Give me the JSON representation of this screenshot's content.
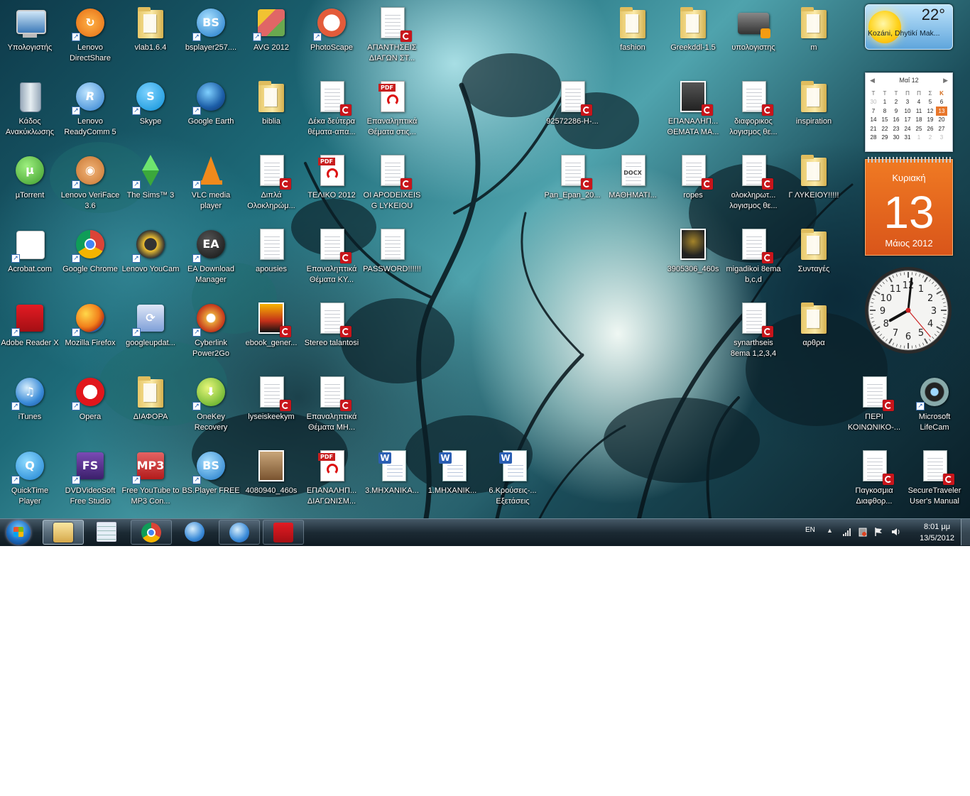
{
  "desktop_icons": [
    {
      "label": "Υπολογιστής",
      "type": "computer"
    },
    {
      "label": "Lenovo DirectShare",
      "type": "directshare",
      "shortcut": true
    },
    {
      "label": "vlab1.6.4",
      "type": "folder"
    },
    {
      "label": "bsplayer257....",
      "type": "bsplayer",
      "shortcut": true
    },
    {
      "label": "AVG 2012",
      "type": "avg",
      "shortcut": true
    },
    {
      "label": "PhotoScape",
      "type": "photoscape",
      "shortcut": true
    },
    {
      "label": "ΑΠΑΝΤΗΣΕΙΣ ΔΙΑΓΩΝ ΣΤ...",
      "type": "pdfthumb"
    },
    {
      "label": "Κάδος Ανακύκλωσης",
      "type": "recycle"
    },
    {
      "label": "Lenovo ReadyComm 5",
      "type": "readycomm",
      "shortcut": true
    },
    {
      "label": "Skype",
      "type": "skype",
      "shortcut": true
    },
    {
      "label": "Google Earth",
      "type": "earth",
      "shortcut": true
    },
    {
      "label": "biblia",
      "type": "folder"
    },
    {
      "label": "Δέκα δεύτερα θέματα-απα...",
      "type": "pdfthumb"
    },
    {
      "label": "Επαναληπτικά Θέματα στις...",
      "type": "pdf"
    },
    {
      "label": "µTorrent",
      "type": "utorrent"
    },
    {
      "label": "Lenovo VeriFace 3.6",
      "type": "veriface",
      "shortcut": true
    },
    {
      "label": "The Sims™ 3",
      "type": "sims",
      "shortcut": true
    },
    {
      "label": "VLC media player",
      "type": "vlc",
      "shortcut": true
    },
    {
      "label": "Διπλά Ολοκληρώμ...",
      "type": "pdfthumb"
    },
    {
      "label": "ΤΕΛΙΚΟ 2012",
      "type": "pdf"
    },
    {
      "label": "OI APODEIXEIS G LYKEIOU",
      "type": "pdfthumb"
    },
    {
      "label": "Acrobat.com",
      "type": "acrobatcom",
      "shortcut": true
    },
    {
      "label": "Google Chrome",
      "type": "chrome",
      "shortcut": true
    },
    {
      "label": "Lenovo YouCam",
      "type": "youcam",
      "shortcut": true
    },
    {
      "label": "EA Download Manager",
      "type": "ea",
      "shortcut": true
    },
    {
      "label": "apousies",
      "type": "doc"
    },
    {
      "label": "Επαναληπτικά Θέματα ΚΥ...",
      "type": "pdfthumb"
    },
    {
      "label": "PASSWORD!!!!!!",
      "type": "doc"
    },
    {
      "label": "Adobe Reader X",
      "type": "reader",
      "shortcut": true
    },
    {
      "label": "Mozilla Firefox",
      "type": "firefox",
      "shortcut": true
    },
    {
      "label": "googleupdat...",
      "type": "gupdate",
      "shortcut": true
    },
    {
      "label": "Cyberlink Power2Go",
      "type": "power2go",
      "shortcut": true
    },
    {
      "label": "ebook_gener...",
      "type": "ebook"
    },
    {
      "label": "Stereo talantosi",
      "type": "pdfthumb"
    },
    {
      "label": "iTunes",
      "type": "itunes",
      "shortcut": true
    },
    {
      "label": "Opera",
      "type": "opera",
      "shortcut": true
    },
    {
      "label": "ΔΙΑΦΟΡΑ",
      "type": "folder"
    },
    {
      "label": "OneKey Recovery",
      "type": "onekey",
      "shortcut": true
    },
    {
      "label": "lyseiskeekym",
      "type": "pdfthumb"
    },
    {
      "label": "Επαναληπτικά Θέματα ΜΗ...",
      "type": "pdfthumb"
    },
    {
      "label": "QuickTime Player",
      "type": "quicktime",
      "shortcut": true
    },
    {
      "label": "DVDVideoSoft Free Studio",
      "type": "dvdvs",
      "shortcut": true
    },
    {
      "label": "Free YouTube to MP3 Con...",
      "type": "ytmp3",
      "shortcut": true
    },
    {
      "label": "BS.Player FREE",
      "type": "bsplayer",
      "shortcut": true
    },
    {
      "label": "4080940_460s",
      "type": "dogphoto"
    },
    {
      "label": "ΕΠΑΝΑΛΗΠ... ΔΙΑΓΩΝΙΣΜ...",
      "type": "pdf"
    },
    {
      "label": "3.ΜΗΧΑΝΙΚΑ...",
      "type": "word"
    },
    {
      "label": "1.ΜΗΧΑΝΙΚ...",
      "type": "word"
    },
    {
      "label": "6.Κρούσεις-... Εξετάσεις",
      "type": "word"
    },
    {
      "label": "fashion",
      "type": "folder"
    },
    {
      "label": "Greekddl-1.5",
      "type": "folder"
    },
    {
      "label": "υπολογιστης",
      "type": "video"
    },
    {
      "label": "m",
      "type": "folder"
    },
    {
      "label": "92572286-Η-...",
      "type": "pdfthumb"
    },
    {
      "label": "ΕΠΑΝΑΛΗΠ... ΘΕΜΑΤΑ ΜΑ...",
      "type": "pdfbook"
    },
    {
      "label": "διαφορικος λογισμος θε...",
      "type": "pdfthumb"
    },
    {
      "label": "inspiration",
      "type": "folder"
    },
    {
      "label": "Pan_Epan_20...",
      "type": "pdfthumb"
    },
    {
      "label": "ΜΑΘΗΜΑΤΙ...",
      "type": "docx"
    },
    {
      "label": "ropes",
      "type": "pdfthumb"
    },
    {
      "label": "ολοκληρωτ... λογισμος θε...",
      "type": "pdfthumb"
    },
    {
      "label": "Γ ΛΥΚΕΙΟΥ!!!!!",
      "type": "folder"
    },
    {
      "label": "3905306_460s",
      "type": "photo2"
    },
    {
      "label": "migadikoi 8ema b,c,d",
      "type": "pdfthumb"
    },
    {
      "label": "Συνταγές",
      "type": "folder"
    },
    {
      "label": "synarthseis 8ema 1,2,3,4",
      "type": "pdfthumb"
    },
    {
      "label": "αρθρα",
      "type": "folder"
    },
    {
      "label": "ΠΕΡΙ ΚΟΙΝΩΝΙΚΟ-...",
      "type": "pdfthumb"
    },
    {
      "label": "Microsoft LifeCam",
      "type": "lifecam",
      "shortcut": true
    },
    {
      "label": "Παγκοσμια Διαφθορ...",
      "type": "pdfthumb"
    },
    {
      "label": "SecureTraveler User's Manual",
      "type": "pdfthumb"
    }
  ],
  "weather": {
    "temp": "22°",
    "location": "Kozáni, Dhytikí Mak..."
  },
  "calendar": {
    "month_label": "Μαΐ 12",
    "weekdays": [
      "Δ",
      "Τ",
      "Τ",
      "Τ",
      "Π",
      "Π",
      "Σ",
      "Κ"
    ],
    "rows": [
      [
        "30",
        "1",
        "2",
        "3",
        "4",
        "5",
        "6"
      ],
      [
        "7",
        "8",
        "9",
        "10",
        "11",
        "12",
        "13"
      ],
      [
        "14",
        "15",
        "16",
        "17",
        "18",
        "19",
        "20"
      ],
      [
        "21",
        "22",
        "23",
        "24",
        "25",
        "26",
        "27"
      ],
      [
        "28",
        "29",
        "30",
        "31",
        "1",
        "2",
        "3"
      ]
    ],
    "today": "13",
    "weekday_name": "Κυριακή",
    "day_number": "13",
    "month_year": "Μάιος 2012"
  },
  "analog_clock": {
    "hour": 8,
    "minute": 1,
    "numerals": [
      "12",
      "1",
      "2",
      "3",
      "4",
      "5",
      "6",
      "7",
      "8",
      "9",
      "10",
      "11"
    ]
  },
  "taskbar": {
    "items": [
      {
        "name": "explorer",
        "state": "active"
      },
      {
        "name": "calculator",
        "state": "none"
      },
      {
        "name": "chrome",
        "state": "open"
      },
      {
        "name": "itunes",
        "state": "none"
      },
      {
        "name": "itunes-2",
        "state": "open"
      },
      {
        "name": "adobe-reader",
        "state": "open"
      }
    ],
    "language": "EN",
    "time": "8:01 μμ",
    "date": "13/5/2012"
  },
  "colors": {
    "accent_orange": "#e8762a",
    "taskbar": "#16252f",
    "pdf_red": "#c8151b",
    "word_blue": "#2b5fb4"
  }
}
